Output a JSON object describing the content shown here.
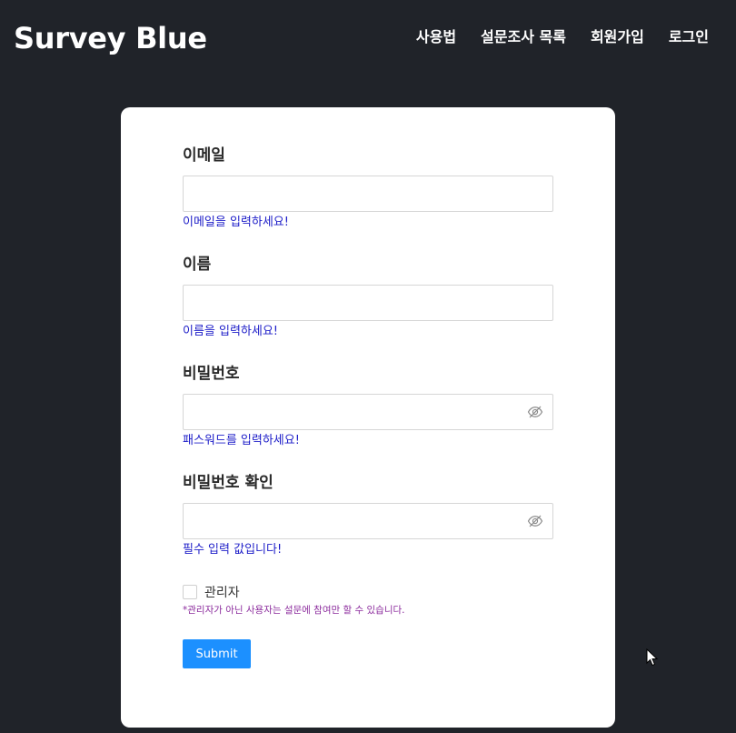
{
  "header": {
    "brand": "Survey Blue",
    "nav": [
      "사용법",
      "설문조사 목록",
      "회원가입",
      "로그인"
    ]
  },
  "form": {
    "email": {
      "label": "이메일",
      "value": "",
      "hint": "이메일을 입력하세요!"
    },
    "name": {
      "label": "이름",
      "value": "",
      "hint": "이름을 입력하세요!"
    },
    "password": {
      "label": "비밀번호",
      "value": "",
      "hint": "패스워드를 입력하세요!"
    },
    "password_confirm": {
      "label": "비밀번호 확인",
      "value": "",
      "hint": "필수 입력 값입니다!"
    },
    "admin": {
      "label": "관리자",
      "checked": false,
      "note": "*관리자가 아닌 사용자는 설문에 참여만 할 수 있습니다."
    },
    "submit_label": "Submit"
  },
  "colors": {
    "background": "#202329",
    "card": "#ffffff",
    "hint": "#1c1cc8",
    "note": "#8b2a9c",
    "primary": "#1c90ff"
  },
  "icons": {
    "password_toggle": "eye-slash-icon",
    "cursor": "mouse-pointer-icon"
  }
}
